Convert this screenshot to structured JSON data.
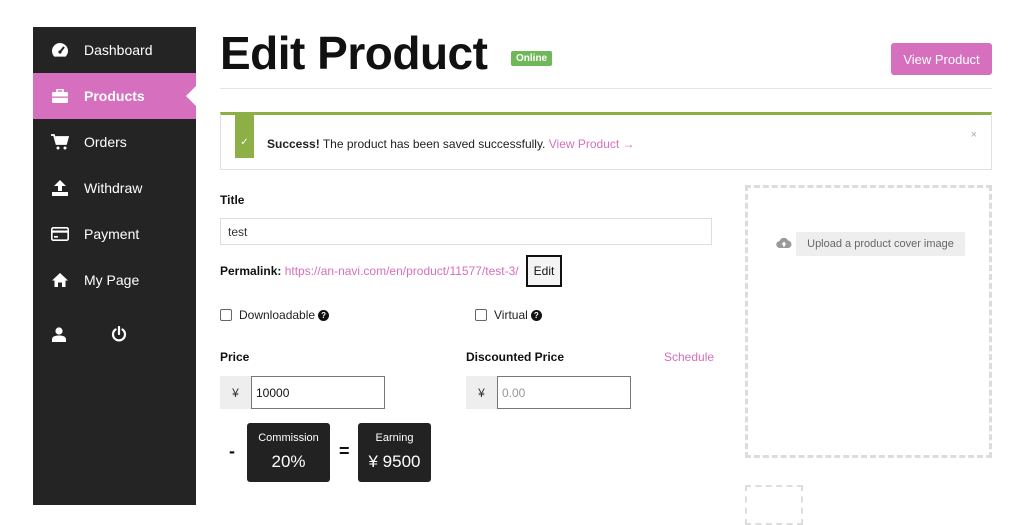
{
  "sidebar": {
    "items": [
      {
        "label": "Dashboard",
        "icon": "dashboard-icon"
      },
      {
        "label": "Products",
        "icon": "briefcase-icon"
      },
      {
        "label": "Orders",
        "icon": "cart-icon"
      },
      {
        "label": "Withdraw",
        "icon": "upload-icon"
      },
      {
        "label": "Payment",
        "icon": "credit-card-icon"
      },
      {
        "label": "My Page",
        "icon": "home-icon"
      }
    ],
    "bottom_icons": [
      "user-icon",
      "power-icon"
    ],
    "accent": "#d56fbe",
    "background": "#242424"
  },
  "header": {
    "title": "Edit Product",
    "status": "Online",
    "view_button": "View Product"
  },
  "alert": {
    "strong": "Success!",
    "message": " The product has been saved successfully. ",
    "link": "View Product →",
    "close": "×",
    "check": "✓"
  },
  "form": {
    "title_label": "Title",
    "title_value": "test",
    "permalink_label": "Permalink:",
    "permalink_url": "https://an-navi.com/en/product/11577/test-3/",
    "edit_label": "Edit",
    "downloadable": "Downloadable",
    "virtual": "Virtual",
    "price_label": "Price",
    "discount_label": "Discounted Price",
    "schedule": "Schedule",
    "currency": "¥",
    "price_value": "10000",
    "discount_placeholder": "0.00",
    "minus": "-",
    "equals": "=",
    "commission_label": "Commission",
    "commission_value": "20%",
    "earning_label": "Earning",
    "earning_value": "¥ 9500"
  },
  "upload": {
    "label": "Upload a product cover image"
  },
  "colors": {
    "accent": "#d56fbe",
    "success": "#8cb046",
    "badge": "#6fb85a"
  }
}
